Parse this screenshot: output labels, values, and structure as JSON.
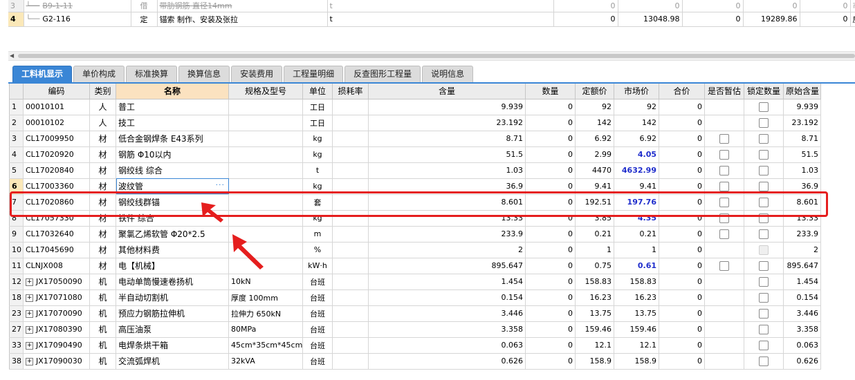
{
  "top_rows": [
    {
      "row_no": "3",
      "code": "B9-1-11",
      "type": "借",
      "name": "带肋钢筋 直径14mm",
      "unit": "t",
      "v1": "0",
      "v2": "0",
      "v3": "0",
      "v4": "0",
      "v5": "0",
      "extra": "市政工",
      "style": "strike"
    },
    {
      "row_no": "4",
      "code": "G2-116",
      "type": "定",
      "name": "锚索 制作、安装及张拉",
      "unit": "t",
      "v1": "0",
      "v2": "13048.98",
      "v3": "0",
      "v4": "19289.86",
      "v5": "0",
      "extra": "房屋建",
      "style": "active"
    }
  ],
  "tabs": [
    "工料机显示",
    "单价构成",
    "标准换算",
    "换算信息",
    "安装费用",
    "工程量明细",
    "反查图形工程量",
    "说明信息"
  ],
  "columns": [
    "编码",
    "类别",
    "名称",
    "规格及型号",
    "单位",
    "损耗率",
    "含量",
    "数量",
    "定额价",
    "市场价",
    "合价",
    "是否暂估",
    "锁定数量",
    "原始含量"
  ],
  "rows": [
    {
      "no": "1",
      "code": "00010101",
      "cat": "人",
      "name": "普工",
      "spec": "",
      "unit": "工日",
      "loss": "",
      "qty_content": "9.939",
      "qty": "0",
      "base_price": "92",
      "market_price": "92",
      "market_hl": false,
      "total": "0",
      "est": "",
      "lock": "box",
      "orig": "9.939",
      "expand": false
    },
    {
      "no": "2",
      "code": "00010102",
      "cat": "人",
      "name": "技工",
      "spec": "",
      "unit": "工日",
      "loss": "",
      "qty_content": "23.192",
      "qty": "0",
      "base_price": "142",
      "market_price": "142",
      "market_hl": false,
      "total": "0",
      "est": "",
      "lock": "box",
      "orig": "23.192",
      "expand": false
    },
    {
      "no": "3",
      "code": "CL17009950",
      "cat": "材",
      "name": "低合金钢焊条 E43系列",
      "spec": "",
      "unit": "kg",
      "loss": "",
      "qty_content": "8.71",
      "qty": "0",
      "base_price": "6.92",
      "market_price": "6.92",
      "market_hl": false,
      "total": "0",
      "est": "box",
      "lock": "box",
      "orig": "8.71",
      "expand": false
    },
    {
      "no": "4",
      "code": "CL17020920",
      "cat": "材",
      "name": "钢筋 Φ10以内",
      "spec": "",
      "unit": "kg",
      "loss": "",
      "qty_content": "51.5",
      "qty": "0",
      "base_price": "2.99",
      "market_price": "4.05",
      "market_hl": true,
      "total": "0",
      "est": "box",
      "lock": "box",
      "orig": "51.5",
      "expand": false
    },
    {
      "no": "5",
      "code": "CL17020840",
      "cat": "材",
      "name": "钢绞线 综合",
      "spec": "",
      "unit": "t",
      "loss": "",
      "qty_content": "1.03",
      "qty": "0",
      "base_price": "4470",
      "market_price": "4632.99",
      "market_hl": true,
      "total": "0",
      "est": "box",
      "lock": "box",
      "orig": "1.03",
      "expand": false
    },
    {
      "no": "6",
      "code": "CL17003360",
      "cat": "材",
      "name": "波纹管",
      "spec": "",
      "unit": "kg",
      "loss": "",
      "qty_content": "36.9",
      "qty": "0",
      "base_price": "9.41",
      "market_price": "9.41",
      "market_hl": false,
      "total": "0",
      "est": "box",
      "lock": "box",
      "orig": "36.9",
      "expand": false,
      "active": true
    },
    {
      "no": "7",
      "code": "CL17020860",
      "cat": "材",
      "name": "钢绞线群锚",
      "spec": "",
      "unit": "套",
      "loss": "",
      "qty_content": "8.601",
      "qty": "0",
      "base_price": "192.51",
      "market_price": "197.76",
      "market_hl": true,
      "total": "0",
      "est": "box",
      "lock": "box",
      "orig": "8.601",
      "expand": false
    },
    {
      "no": "8",
      "code": "CL17057330",
      "cat": "材",
      "name": "铁件 综合",
      "spec": "",
      "unit": "kg",
      "loss": "",
      "qty_content": "13.33",
      "qty": "0",
      "base_price": "3.85",
      "market_price": "4.35",
      "market_hl": true,
      "total": "0",
      "est": "box",
      "lock": "box",
      "orig": "13.33",
      "expand": false
    },
    {
      "no": "9",
      "code": "CL17032640",
      "cat": "材",
      "name": "聚氯乙烯软管 Φ20*2.5",
      "spec": "",
      "unit": "m",
      "loss": "",
      "qty_content": "233.9",
      "qty": "0",
      "base_price": "0.21",
      "market_price": "0.21",
      "market_hl": false,
      "total": "0",
      "est": "box",
      "lock": "box",
      "orig": "233.9",
      "expand": false
    },
    {
      "no": "10",
      "code": "CL17045690",
      "cat": "材",
      "name": "其他材料费",
      "spec": "",
      "unit": "%",
      "loss": "",
      "qty_content": "2",
      "qty": "0",
      "base_price": "1",
      "market_price": "1",
      "market_hl": false,
      "total": "0",
      "est": "",
      "lock": "disabled",
      "orig": "2",
      "expand": false
    },
    {
      "no": "11",
      "code": "CLNJX008",
      "cat": "材",
      "name": "电【机械】",
      "spec": "",
      "unit": "kW·h",
      "loss": "",
      "qty_content": "895.647",
      "qty": "0",
      "base_price": "0.75",
      "market_price": "0.61",
      "market_hl": true,
      "total": "0",
      "est": "box",
      "lock": "box",
      "orig": "895.647",
      "expand": false
    },
    {
      "no": "12",
      "code": "JX17050090",
      "cat": "机",
      "name": "电动单筒慢速卷扬机",
      "spec": "10kN",
      "unit": "台班",
      "loss": "",
      "qty_content": "1.454",
      "qty": "0",
      "base_price": "158.83",
      "market_price": "158.83",
      "market_hl": false,
      "total": "0",
      "est": "",
      "lock": "box",
      "orig": "1.454",
      "expand": true
    },
    {
      "no": "18",
      "code": "JX17071080",
      "cat": "机",
      "name": "半自动切割机",
      "spec": "厚度 100mm",
      "unit": "台班",
      "loss": "",
      "qty_content": "0.154",
      "qty": "0",
      "base_price": "16.23",
      "market_price": "16.23",
      "market_hl": false,
      "total": "0",
      "est": "",
      "lock": "box",
      "orig": "0.154",
      "expand": true
    },
    {
      "no": "23",
      "code": "JX17070090",
      "cat": "机",
      "name": "预应力钢筋拉伸机",
      "spec": "拉伸力 650kN",
      "unit": "台班",
      "loss": "",
      "qty_content": "3.446",
      "qty": "0",
      "base_price": "13.75",
      "market_price": "13.75",
      "market_hl": false,
      "total": "0",
      "est": "",
      "lock": "box",
      "orig": "3.446",
      "expand": true
    },
    {
      "no": "27",
      "code": "JX17080390",
      "cat": "机",
      "name": "高压油泵",
      "spec": "80MPa",
      "unit": "台班",
      "loss": "",
      "qty_content": "3.358",
      "qty": "0",
      "base_price": "159.46",
      "market_price": "159.46",
      "market_hl": false,
      "total": "0",
      "est": "",
      "lock": "box",
      "orig": "3.358",
      "expand": true
    },
    {
      "no": "33",
      "code": "JX17090490",
      "cat": "机",
      "name": "电焊条烘干箱",
      "spec": "45cm*35cm*45cm",
      "unit": "台班",
      "loss": "",
      "qty_content": "0.063",
      "qty": "0",
      "base_price": "12.1",
      "market_price": "12.1",
      "market_hl": false,
      "total": "0",
      "est": "",
      "lock": "box",
      "orig": "0.063",
      "expand": true
    },
    {
      "no": "38",
      "code": "JX17090030",
      "cat": "机",
      "name": "交流弧焊机",
      "spec": "32kVA",
      "unit": "台班",
      "loss": "",
      "qty_content": "0.626",
      "qty": "0",
      "base_price": "158.9",
      "market_price": "158.9",
      "market_hl": false,
      "total": "0",
      "est": "",
      "lock": "box",
      "orig": "0.626",
      "expand": true
    }
  ],
  "colors": {
    "accent": "#3a86d6",
    "highlight": "#e51e1e",
    "price_changed": "#1f2dcc"
  }
}
